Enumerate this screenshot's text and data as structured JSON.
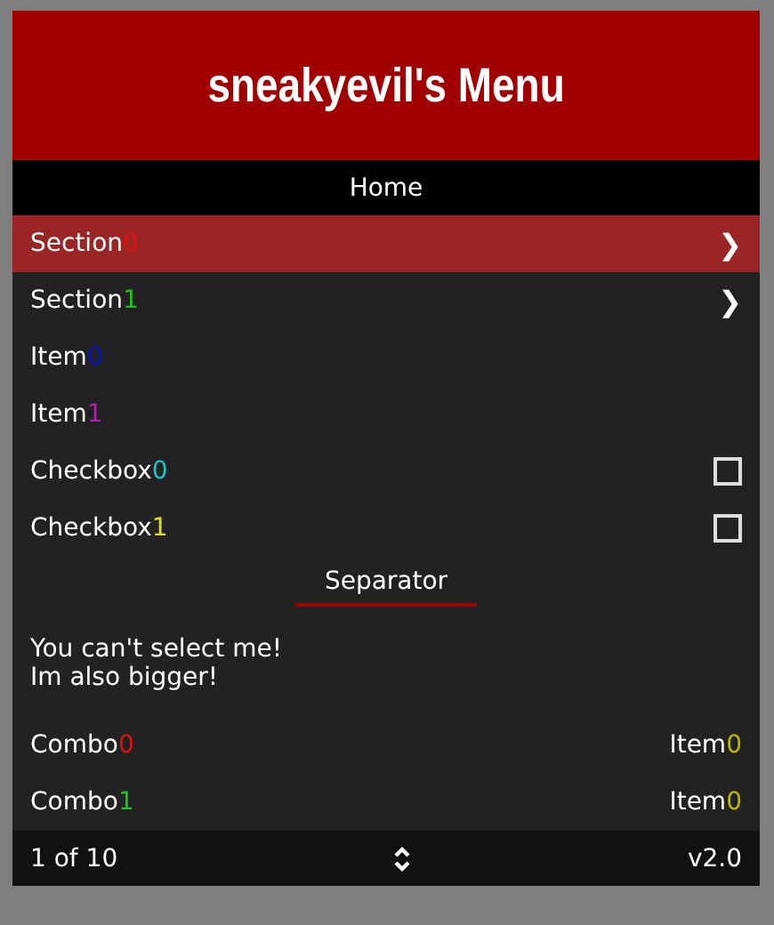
{
  "header": {
    "title": "sneakyevil's Menu"
  },
  "subtitle": "Home",
  "items": [
    {
      "kind": "submenu",
      "label": "Section",
      "suffix": "0",
      "color": "#e01010",
      "selected": true,
      "arrow": "❯"
    },
    {
      "kind": "submenu",
      "label": "Section",
      "suffix": "1",
      "color": "#20c020",
      "selected": false,
      "arrow": "❯"
    },
    {
      "kind": "item",
      "label": "Item",
      "suffix": "0",
      "color": "#1010c0",
      "selected": false
    },
    {
      "kind": "item",
      "label": "Item",
      "suffix": "1",
      "color": "#b020b0",
      "selected": false
    },
    {
      "kind": "checkbox",
      "label": "Checkbox",
      "suffix": "0",
      "color": "#20c0c0",
      "selected": false,
      "checked": false
    },
    {
      "kind": "checkbox",
      "label": "Checkbox",
      "suffix": "1",
      "color": "#e0e020",
      "selected": false,
      "checked": false
    },
    {
      "kind": "separator",
      "label": "Separator"
    },
    {
      "kind": "text",
      "lines": [
        "You can't select me!",
        "Im also bigger!"
      ]
    },
    {
      "kind": "combo",
      "label": "Combo",
      "suffix": "0",
      "color": "#e01010",
      "selected": false,
      "value": {
        "label": "Item",
        "suffix": "0",
        "color": "#b8b800"
      }
    },
    {
      "kind": "combo",
      "label": "Combo",
      "suffix": "1",
      "color": "#20c020",
      "selected": false,
      "value": {
        "label": "Item",
        "suffix": "0",
        "color": "#b8b800"
      }
    }
  ],
  "footer": {
    "position": "1 of 10",
    "version": "v2.0"
  }
}
